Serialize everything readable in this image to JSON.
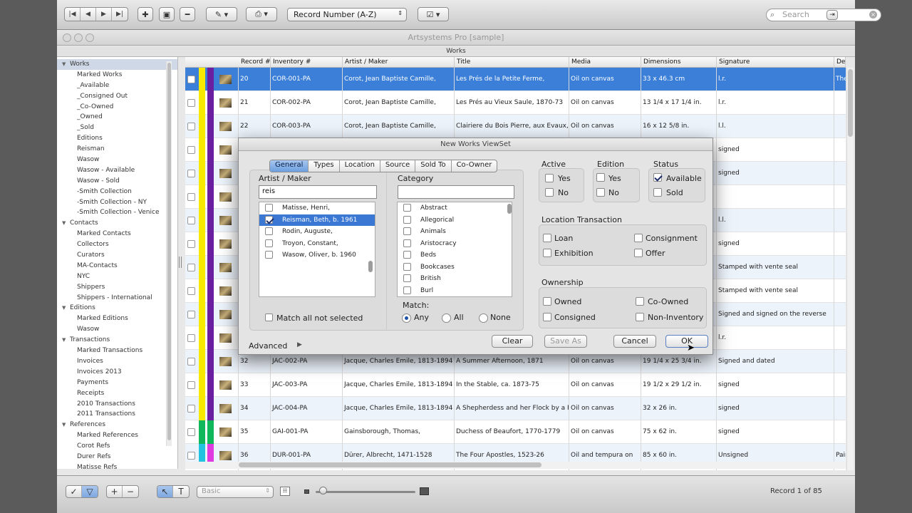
{
  "toolbar": {
    "sort_select": "Record Number (A-Z)",
    "search_placeholder": "Search"
  },
  "window": {
    "title": "Artsystems Pro [sample]",
    "view_label": "Works"
  },
  "sidebar": {
    "items": [
      {
        "label": "Works",
        "type": "head",
        "selected": true
      },
      {
        "label": "Marked Works",
        "type": "item"
      },
      {
        "label": "_Available",
        "type": "item"
      },
      {
        "label": "_Consigned Out",
        "type": "item"
      },
      {
        "label": "_Co-Owned",
        "type": "item"
      },
      {
        "label": "_Owned",
        "type": "item"
      },
      {
        "label": "_Sold",
        "type": "item"
      },
      {
        "label": "Editions",
        "type": "item"
      },
      {
        "label": "Reisman",
        "type": "item"
      },
      {
        "label": "Wasow",
        "type": "item"
      },
      {
        "label": "Wasow - Available",
        "type": "item"
      },
      {
        "label": "Wasow - Sold",
        "type": "item"
      },
      {
        "label": "-Smith Collection",
        "type": "item"
      },
      {
        "label": "-Smith Collection - NY",
        "type": "item"
      },
      {
        "label": "-Smith Collection - Venice",
        "type": "item"
      },
      {
        "label": "Contacts",
        "type": "head"
      },
      {
        "label": "Marked Contacts",
        "type": "item"
      },
      {
        "label": "Collectors",
        "type": "item"
      },
      {
        "label": "Curators",
        "type": "item"
      },
      {
        "label": "MA-Contacts",
        "type": "item"
      },
      {
        "label": "NYC",
        "type": "item"
      },
      {
        "label": "Shippers",
        "type": "item"
      },
      {
        "label": "Shippers - International",
        "type": "item"
      },
      {
        "label": "Editions",
        "type": "head"
      },
      {
        "label": "Marked Editions",
        "type": "item"
      },
      {
        "label": "Wasow",
        "type": "item"
      },
      {
        "label": "Transactions",
        "type": "head"
      },
      {
        "label": "Marked Transactions",
        "type": "item"
      },
      {
        "label": "Invoices",
        "type": "item"
      },
      {
        "label": "Invoices 2013",
        "type": "item"
      },
      {
        "label": "Payments",
        "type": "item"
      },
      {
        "label": "Receipts",
        "type": "item"
      },
      {
        "label": "2010 Transactions",
        "type": "item"
      },
      {
        "label": "2011 Transactions",
        "type": "item"
      },
      {
        "label": "References",
        "type": "head"
      },
      {
        "label": "Marked References",
        "type": "item"
      },
      {
        "label": "Corot Refs",
        "type": "item"
      },
      {
        "label": "Durer Refs",
        "type": "item"
      },
      {
        "label": "Matisse Refs",
        "type": "item"
      }
    ]
  },
  "table": {
    "columns": [
      "Record #",
      "Inventory #",
      "Artist / Maker",
      "Title",
      "Media",
      "Dimensions",
      "Signature",
      "De"
    ],
    "rows": [
      {
        "rec": "20",
        "inv": "COR-001-PA",
        "artist": "Corot, Jean Baptiste Camille,",
        "title": "Les Prés de la Petite Ferme,",
        "media": "Oil on canvas",
        "dims": "33 x 46.3 cm",
        "sig": "l.r.",
        "desc": "The",
        "sel": true,
        "stripe": "#f7ea00"
      },
      {
        "rec": "21",
        "inv": "COR-002-PA",
        "artist": "Corot, Jean Baptiste Camille,",
        "title": "Les Prés au Vieux Saule, 1870-73",
        "media": "Oil on canvas",
        "dims": "13 1/4 x 17 1/4 in.",
        "sig": "l.r.",
        "desc": "",
        "stripe": "#f7ea00"
      },
      {
        "rec": "22",
        "inv": "COR-003-PA",
        "artist": "Corot, Jean Baptiste Camille,",
        "title": "Clairiere du Bois Pierre, aux Evaux, Près ...",
        "media": "Oil on canvas",
        "dims": "16 x 12 5/8 in.",
        "sig": "l.l.",
        "desc": "",
        "stripe": "#f7ea00"
      },
      {
        "rec": "",
        "inv": "",
        "artist": "",
        "title": "",
        "media": "",
        "dims": "",
        "sig": "signed",
        "desc": "",
        "stripe": "#f7ea00"
      },
      {
        "rec": "",
        "inv": "",
        "artist": "",
        "title": "",
        "media": "",
        "dims": "",
        "sig": "signed",
        "desc": "",
        "stripe": "#f7ea00"
      },
      {
        "rec": "",
        "inv": "",
        "artist": "",
        "title": "",
        "media": "",
        "dims": "",
        "sig": "",
        "desc": "",
        "stripe": "#f7ea00"
      },
      {
        "rec": "",
        "inv": "",
        "artist": "",
        "title": "",
        "media": "",
        "dims": "",
        "sig": "l.l.",
        "desc": "",
        "stripe": "#f7ea00"
      },
      {
        "rec": "",
        "inv": "",
        "artist": "",
        "title": "",
        "media": "",
        "dims": "",
        "sig": "signed",
        "desc": "",
        "stripe": "#f7ea00"
      },
      {
        "rec": "",
        "inv": "",
        "artist": "",
        "title": "",
        "media": "",
        "dims": "",
        "sig": "Stamped with vente seal",
        "desc": "",
        "stripe": "#f7ea00"
      },
      {
        "rec": "",
        "inv": "",
        "artist": "",
        "title": "",
        "media": "",
        "dims": "",
        "sig": "Stamped with vente seal",
        "desc": "",
        "stripe": "#f7ea00"
      },
      {
        "rec": "",
        "inv": "",
        "artist": "",
        "title": "",
        "media": "",
        "dims": "",
        "sig": "Signed and signed on the reverse",
        "desc": "",
        "stripe": "#f7ea00"
      },
      {
        "rec": "",
        "inv": "",
        "artist": "",
        "title": "",
        "media": "",
        "dims": "",
        "sig": "l.r.",
        "desc": "",
        "stripe": "#f7ea00"
      },
      {
        "rec": "32",
        "inv": "JAC-002-PA",
        "artist": "Jacque, Charles Emile, 1813-1894",
        "title": "A Summer Afternoon, 1871",
        "media": "Oil on canvas",
        "dims": "19 1/4 x 25 3/4 in.",
        "sig": "Signed and dated",
        "desc": "",
        "stripe": "#f7ea00"
      },
      {
        "rec": "33",
        "inv": "JAC-003-PA",
        "artist": "Jacque, Charles Emile, 1813-1894",
        "title": "In the Stable, ca. 1873-75",
        "media": "Oil on canvas",
        "dims": "19 1/2 x 29 1/2 in.",
        "sig": "signed",
        "desc": "",
        "stripe": "#f7ea00"
      },
      {
        "rec": "34",
        "inv": "JAC-004-PA",
        "artist": "Jacque, Charles Emile, 1813-1894",
        "title": "A Shepherdess and her Flock by a Pool,",
        "media": "Oil on canvas",
        "dims": "32 x 26 in.",
        "sig": "signed",
        "desc": "",
        "stripe": "#f7ea00"
      },
      {
        "rec": "35",
        "inv": "GAI-001-PA",
        "artist": "Gainsborough, Thomas,",
        "title": "Duchess of Beaufort, 1770-1779",
        "media": "Oil on canvas",
        "dims": "75 x 62 in.",
        "sig": "signed",
        "desc": "",
        "stripe": "#0fb85a"
      },
      {
        "rec": "36",
        "inv": "DUR-001-PA",
        "artist": "Dürer, Albrecht, 1471-1528",
        "title": "The Four Apostles, 1523-26",
        "media": "Oil and tempura on",
        "dims": "85 x 60 in.",
        "sig": "Unsigned",
        "desc": "Pair",
        "stripe": "#22c3e0"
      }
    ]
  },
  "dialog": {
    "title": "New Works ViewSet",
    "tabs": [
      "General",
      "Types",
      "Location",
      "Source",
      "Sold To",
      "Co-Owner"
    ],
    "artist_label": "Artist / Maker",
    "artist_query": "reis",
    "artists": [
      {
        "label": "Matisse, Henri,",
        "checked": false,
        "sel": false
      },
      {
        "label": "Reisman, Beth, b. 1961",
        "checked": true,
        "sel": true
      },
      {
        "label": "Rodin, Auguste,",
        "checked": false,
        "sel": false
      },
      {
        "label": "Troyon, Constant,",
        "checked": false,
        "sel": false
      },
      {
        "label": "Wasow, Oliver, b. 1960",
        "checked": false,
        "sel": false
      }
    ],
    "match_all_label": "Match all not selected",
    "category_label": "Category",
    "categories": [
      "Abstract",
      "Allegorical",
      "Animals",
      "Aristocracy",
      "Beds",
      "Bookcases",
      "British",
      "Burl"
    ],
    "match_label": "Match:",
    "match_options": [
      "Any",
      "All",
      "None"
    ],
    "active": {
      "label": "Active",
      "yes": "Yes",
      "no": "No"
    },
    "edition": {
      "label": "Edition",
      "yes": "Yes",
      "no": "No"
    },
    "status": {
      "label": "Status",
      "available": "Available",
      "sold": "Sold"
    },
    "location_transaction": {
      "label": "Location Transaction",
      "loan": "Loan",
      "consignment": "Consignment",
      "exhibition": "Exhibition",
      "offer": "Offer"
    },
    "ownership": {
      "label": "Ownership",
      "owned": "Owned",
      "co_owned": "Co-Owned",
      "consigned": "Consigned",
      "non_inventory": "Non-Inventory"
    },
    "advanced_label": "Advanced",
    "buttons": {
      "clear": "Clear",
      "save_as": "Save As",
      "cancel": "Cancel",
      "ok": "OK"
    }
  },
  "bottombar": {
    "layout_select": "Basic",
    "record_count": "Record 1 of 85"
  },
  "colors": {
    "selection": "#3b7fd9",
    "tab_active": "#6d9fe0",
    "purple_stripe": "#6a1fa0",
    "magenta_stripe": "#e03be0"
  }
}
